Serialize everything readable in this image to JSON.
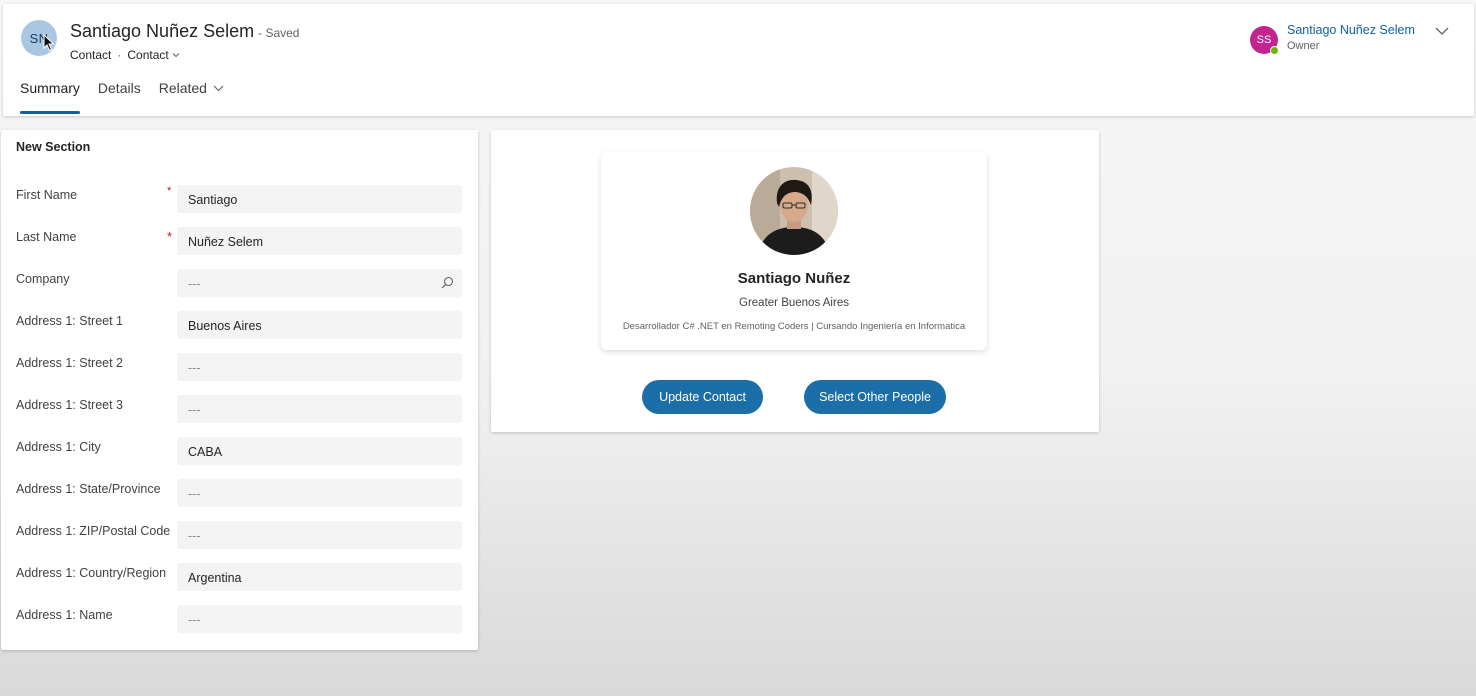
{
  "header": {
    "avatar_initials": "SN",
    "title": "Santiago Nuñez Selem",
    "save_state": "- Saved",
    "entity": "Contact",
    "form_selector": "Contact",
    "owner": {
      "initials": "SS",
      "name": "Santiago Nuñez Selem",
      "role": "Owner",
      "presence_color": "#6bb700"
    }
  },
  "tabs": [
    {
      "label": "Summary",
      "active": true
    },
    {
      "label": "Details",
      "active": false
    },
    {
      "label": "Related",
      "active": false
    }
  ],
  "section": {
    "title": "New Section",
    "fields": [
      {
        "label": "First Name",
        "value": "Santiago",
        "required": true,
        "required_mark": "*"
      },
      {
        "label": "Last Name",
        "value": "Nuñez Selem",
        "required": true,
        "required_mark": "*"
      },
      {
        "label": "Company",
        "value": "---",
        "required": false,
        "lookup": true
      },
      {
        "label": "Address 1: Street 1",
        "value": "Buenos Aires",
        "required": false
      },
      {
        "label": "Address 1: Street 2",
        "value": "---",
        "required": false
      },
      {
        "label": "Address 1: Street 3",
        "value": "---",
        "required": false
      },
      {
        "label": "Address 1: City",
        "value": "CABA",
        "required": false
      },
      {
        "label": "Address 1: State/Province",
        "value": "---",
        "required": false
      },
      {
        "label": "Address 1: ZIP/Postal Code",
        "value": "---",
        "required": false
      },
      {
        "label": "Address 1: Country/Region",
        "value": "Argentina",
        "required": false
      },
      {
        "label": "Address 1: Name",
        "value": "---",
        "required": false
      }
    ]
  },
  "profile": {
    "name": "Santiago Nuñez",
    "location": "Greater Buenos Aires",
    "headline": "Desarrollador C# .NET en Remoting Coders | Cursando Ingeniería en Informatica",
    "buttons": {
      "update": "Update Contact",
      "select": "Select Other People"
    }
  },
  "colors": {
    "accent": "#115ea3",
    "button": "#1b6ea8",
    "record_avatar": "#a9c7e3",
    "owner_avatar": "#c2258e",
    "required": "#c50f1f"
  }
}
